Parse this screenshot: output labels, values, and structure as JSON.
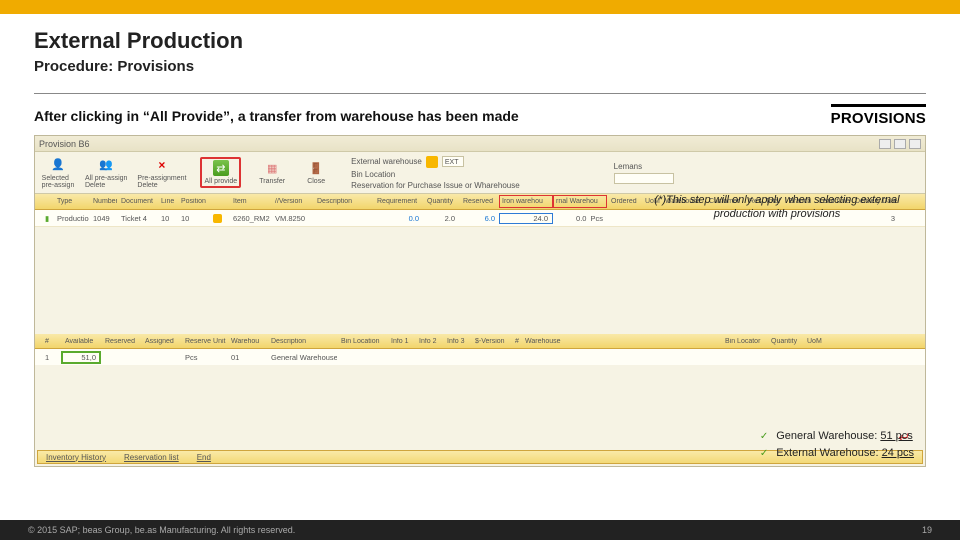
{
  "header": {
    "title": "External Production",
    "subtitle": "Procedure: Provisions"
  },
  "note": "After clicking in “All Provide”, a transfer from warehouse has been made",
  "callout": "PROVISIONS",
  "app": {
    "window_title": "Provision B6",
    "toolbar": {
      "selected": "Selected\npre-assign",
      "all_preassign": "All pre-assign\nDelete",
      "pre_assignment": "Pre-assignment\nDelete",
      "close_x": "×",
      "all_provide": "All provide",
      "transfer": "Transfer",
      "close": "Close",
      "fields": {
        "ext_wh_label": "External warehouse",
        "ext_wh_val": "EXT",
        "bin_loc_label": "Bin Location",
        "reservation_label": "Reservation for Purchase Issue or Wharehouse"
      },
      "lemans": "Lemans"
    },
    "top_headers": [
      "",
      "Type",
      "Number",
      "Document",
      "Line",
      "Position",
      "",
      "",
      "Item",
      "//Version",
      "Description",
      "",
      "Requirement",
      "Quantity",
      "Reserved",
      "Iron warehou",
      "rnal Warehou",
      "",
      "Ordered",
      "UoM",
      "",
      "Warehouse",
      "Customer",
      "",
      "Res. Total",
      "Branch",
      "Lead time",
      "Delivery Date"
    ],
    "top_row": {
      "type": "Production",
      "number": "1049",
      "doc": "Ticket 4",
      "line": "10",
      "pos": "10",
      "item": "6260_RM2",
      "ver": "VM.8250",
      "req": "0.0",
      "qty": "2.0",
      "res": "6.0",
      "iron": "24.0",
      "ext": "0.0",
      "uom": "Pcs",
      "ordered": "",
      "cust": "3"
    },
    "bot_headers": [
      "#",
      "",
      "Available",
      "Reserved",
      "Assigned",
      "",
      "Reserve Unit",
      "",
      "",
      "Warehou",
      "Description",
      "",
      "",
      "",
      "Bin Location",
      "Info 1",
      "Info 2",
      "",
      "Info 3",
      "$-Version",
      "#",
      "",
      "",
      "Warehouse",
      "",
      "",
      "",
      "",
      "Bin Locator",
      "",
      "Quantity",
      "UoM"
    ],
    "bot_row": {
      "available": "51,0",
      "reserved": "",
      "assigned": "",
      "unit": "Pcs",
      "wh": "01",
      "desc": "General Warehouse"
    },
    "bottom_buttons": {
      "inv": "Inventory History",
      "res": "Reservation list",
      "end": "End"
    }
  },
  "note2": "(*)This step will only apply when selecting external production with provisions",
  "results": {
    "general": "General Warehouse: ",
    "general_qty": "51 pcs",
    "external": "External Warehouse: ",
    "external_qty": "24 pcs"
  },
  "footer": {
    "copyright": "© 2015 SAP; beas Group, be.as Manufacturing. All rights reserved.",
    "page": "19",
    "arrow": "↵"
  }
}
